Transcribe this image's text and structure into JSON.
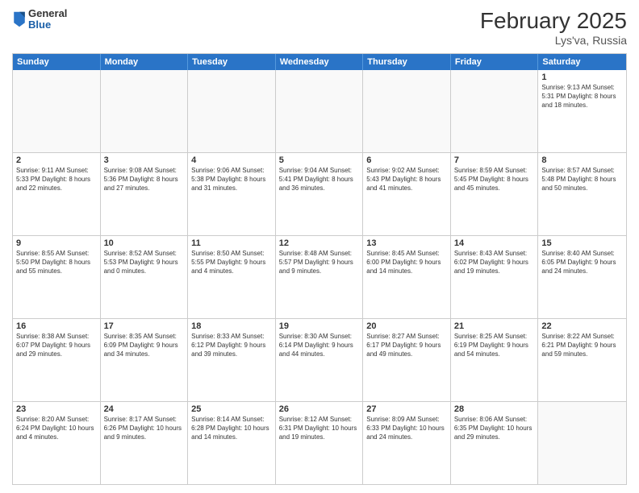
{
  "header": {
    "logo": {
      "general": "General",
      "blue": "Blue"
    },
    "title": "February 2025",
    "location": "Lys'va, Russia"
  },
  "weekdays": [
    "Sunday",
    "Monday",
    "Tuesday",
    "Wednesday",
    "Thursday",
    "Friday",
    "Saturday"
  ],
  "weeks": [
    [
      {
        "day": "",
        "info": ""
      },
      {
        "day": "",
        "info": ""
      },
      {
        "day": "",
        "info": ""
      },
      {
        "day": "",
        "info": ""
      },
      {
        "day": "",
        "info": ""
      },
      {
        "day": "",
        "info": ""
      },
      {
        "day": "1",
        "info": "Sunrise: 9:13 AM\nSunset: 5:31 PM\nDaylight: 8 hours and 18 minutes."
      }
    ],
    [
      {
        "day": "2",
        "info": "Sunrise: 9:11 AM\nSunset: 5:33 PM\nDaylight: 8 hours and 22 minutes."
      },
      {
        "day": "3",
        "info": "Sunrise: 9:08 AM\nSunset: 5:36 PM\nDaylight: 8 hours and 27 minutes."
      },
      {
        "day": "4",
        "info": "Sunrise: 9:06 AM\nSunset: 5:38 PM\nDaylight: 8 hours and 31 minutes."
      },
      {
        "day": "5",
        "info": "Sunrise: 9:04 AM\nSunset: 5:41 PM\nDaylight: 8 hours and 36 minutes."
      },
      {
        "day": "6",
        "info": "Sunrise: 9:02 AM\nSunset: 5:43 PM\nDaylight: 8 hours and 41 minutes."
      },
      {
        "day": "7",
        "info": "Sunrise: 8:59 AM\nSunset: 5:45 PM\nDaylight: 8 hours and 45 minutes."
      },
      {
        "day": "8",
        "info": "Sunrise: 8:57 AM\nSunset: 5:48 PM\nDaylight: 8 hours and 50 minutes."
      }
    ],
    [
      {
        "day": "9",
        "info": "Sunrise: 8:55 AM\nSunset: 5:50 PM\nDaylight: 8 hours and 55 minutes."
      },
      {
        "day": "10",
        "info": "Sunrise: 8:52 AM\nSunset: 5:53 PM\nDaylight: 9 hours and 0 minutes."
      },
      {
        "day": "11",
        "info": "Sunrise: 8:50 AM\nSunset: 5:55 PM\nDaylight: 9 hours and 4 minutes."
      },
      {
        "day": "12",
        "info": "Sunrise: 8:48 AM\nSunset: 5:57 PM\nDaylight: 9 hours and 9 minutes."
      },
      {
        "day": "13",
        "info": "Sunrise: 8:45 AM\nSunset: 6:00 PM\nDaylight: 9 hours and 14 minutes."
      },
      {
        "day": "14",
        "info": "Sunrise: 8:43 AM\nSunset: 6:02 PM\nDaylight: 9 hours and 19 minutes."
      },
      {
        "day": "15",
        "info": "Sunrise: 8:40 AM\nSunset: 6:05 PM\nDaylight: 9 hours and 24 minutes."
      }
    ],
    [
      {
        "day": "16",
        "info": "Sunrise: 8:38 AM\nSunset: 6:07 PM\nDaylight: 9 hours and 29 minutes."
      },
      {
        "day": "17",
        "info": "Sunrise: 8:35 AM\nSunset: 6:09 PM\nDaylight: 9 hours and 34 minutes."
      },
      {
        "day": "18",
        "info": "Sunrise: 8:33 AM\nSunset: 6:12 PM\nDaylight: 9 hours and 39 minutes."
      },
      {
        "day": "19",
        "info": "Sunrise: 8:30 AM\nSunset: 6:14 PM\nDaylight: 9 hours and 44 minutes."
      },
      {
        "day": "20",
        "info": "Sunrise: 8:27 AM\nSunset: 6:17 PM\nDaylight: 9 hours and 49 minutes."
      },
      {
        "day": "21",
        "info": "Sunrise: 8:25 AM\nSunset: 6:19 PM\nDaylight: 9 hours and 54 minutes."
      },
      {
        "day": "22",
        "info": "Sunrise: 8:22 AM\nSunset: 6:21 PM\nDaylight: 9 hours and 59 minutes."
      }
    ],
    [
      {
        "day": "23",
        "info": "Sunrise: 8:20 AM\nSunset: 6:24 PM\nDaylight: 10 hours and 4 minutes."
      },
      {
        "day": "24",
        "info": "Sunrise: 8:17 AM\nSunset: 6:26 PM\nDaylight: 10 hours and 9 minutes."
      },
      {
        "day": "25",
        "info": "Sunrise: 8:14 AM\nSunset: 6:28 PM\nDaylight: 10 hours and 14 minutes."
      },
      {
        "day": "26",
        "info": "Sunrise: 8:12 AM\nSunset: 6:31 PM\nDaylight: 10 hours and 19 minutes."
      },
      {
        "day": "27",
        "info": "Sunrise: 8:09 AM\nSunset: 6:33 PM\nDaylight: 10 hours and 24 minutes."
      },
      {
        "day": "28",
        "info": "Sunrise: 8:06 AM\nSunset: 6:35 PM\nDaylight: 10 hours and 29 minutes."
      },
      {
        "day": "",
        "info": ""
      }
    ]
  ]
}
